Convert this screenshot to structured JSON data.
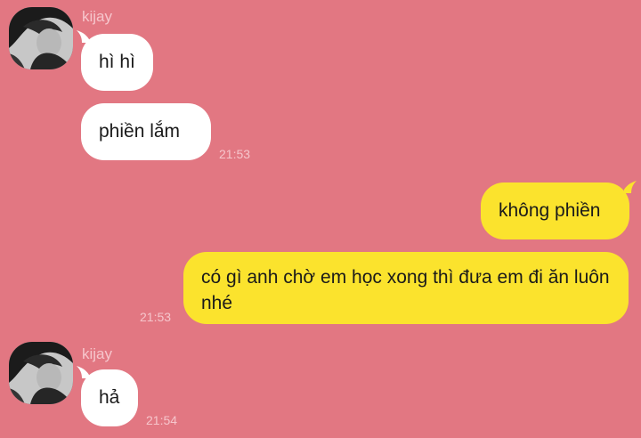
{
  "chat": {
    "messages": [
      {
        "sender": "kijay",
        "text": "hì hì"
      },
      {
        "text": "phiền lắm",
        "time": "21:53"
      },
      {
        "text": "không phiền"
      },
      {
        "text": "có gì anh chờ em học xong thì đưa em đi ăn luôn nhé",
        "time": "21:53"
      },
      {
        "sender": "kijay",
        "text": "hả",
        "time": "21:54"
      }
    ]
  },
  "icons": [
    "avatar-photo"
  ],
  "colors": {
    "background": "#e27782",
    "incoming_bubble": "#ffffff",
    "outgoing_bubble": "#fbe32d",
    "meta_text": "#f6c6cc"
  }
}
